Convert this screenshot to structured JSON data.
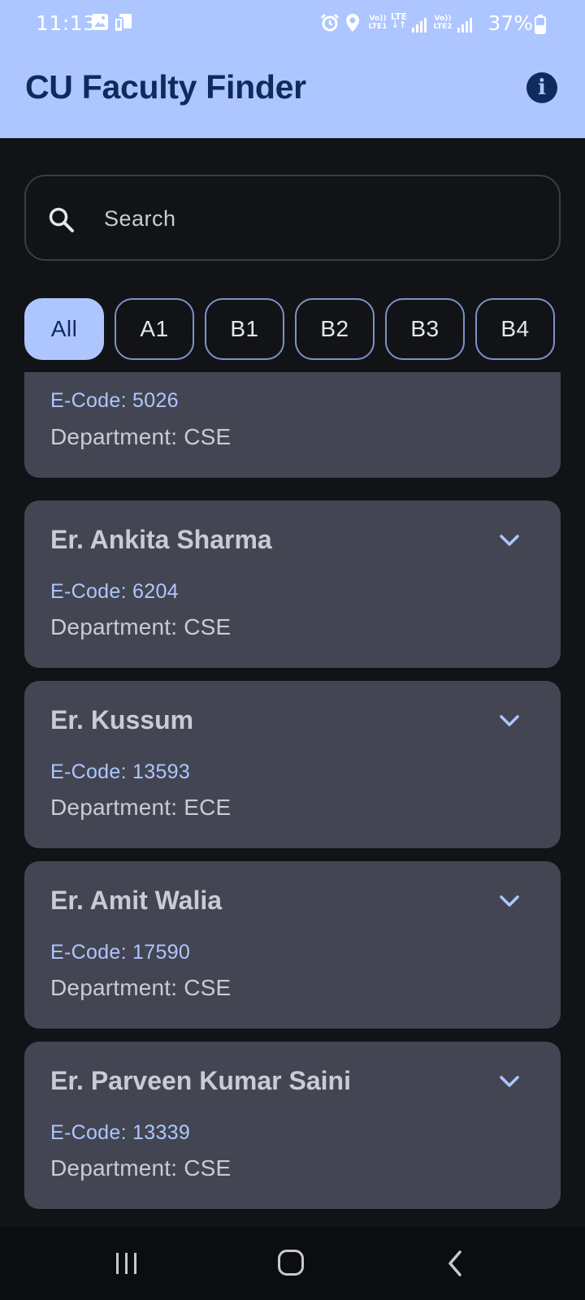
{
  "status_bar": {
    "time": "11:13",
    "net1_top": "Vo))",
    "net1_bottom": "LTE1",
    "lte_label": "LTE",
    "net2_top": "Vo))",
    "net2_bottom": "LTE2",
    "battery": "37%",
    "icons": [
      "gallery-icon",
      "screen-mirror-icon",
      "alarm-icon",
      "location-icon",
      "signal-icon",
      "signal-icon",
      "battery-icon"
    ]
  },
  "app_bar": {
    "title": "CU Faculty Finder",
    "info_icon": "info-icon",
    "info_glyph": "i"
  },
  "search": {
    "placeholder": "Search",
    "value": ""
  },
  "filters": {
    "selected": "All",
    "chips": [
      "All",
      "A1",
      "B1",
      "B2",
      "B3",
      "B4"
    ]
  },
  "faculty": [
    {
      "name": "",
      "ecode": "E-Code: 5026",
      "department": "Department: CSE"
    },
    {
      "name": "Er. Ankita Sharma",
      "ecode": "E-Code: 6204",
      "department": "Department: CSE"
    },
    {
      "name": "Er. Kussum",
      "ecode": "E-Code: 13593",
      "department": "Department: ECE"
    },
    {
      "name": "Er. Amit Walia",
      "ecode": "E-Code: 17590",
      "department": "Department: CSE"
    },
    {
      "name": "Er. Parveen Kumar Saini",
      "ecode": "E-Code: 13339",
      "department": "Department: CSE"
    }
  ],
  "colors": {
    "primary_container": "#aec6ff",
    "on_primary_container": "#0f2a5c",
    "background": "#121317",
    "card": "#434652",
    "accent_text": "#aec6ff",
    "card_text": "#c9ccd4"
  }
}
